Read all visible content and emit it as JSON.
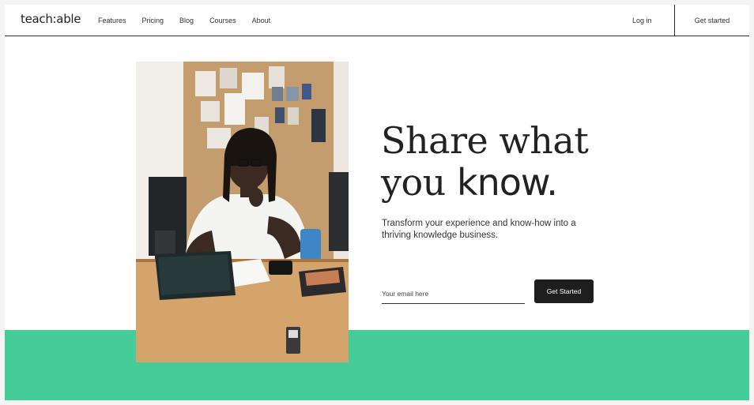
{
  "nav": {
    "logo": "teach:able",
    "links": [
      "Features",
      "Pricing",
      "Blog",
      "Courses",
      "About"
    ],
    "login": "Log in",
    "cta": "Get started"
  },
  "hero": {
    "headline_line1": "Share what",
    "headline_line2_serif": "you ",
    "headline_line2_sans": "know.",
    "subtitle": "Transform your experience and know-how into a thriving knowledge business.",
    "email_placeholder": "Your email here",
    "submit_label": "Get Started"
  },
  "colors": {
    "brand_green": "#45cc98",
    "button_dark": "#1e1e1e"
  }
}
